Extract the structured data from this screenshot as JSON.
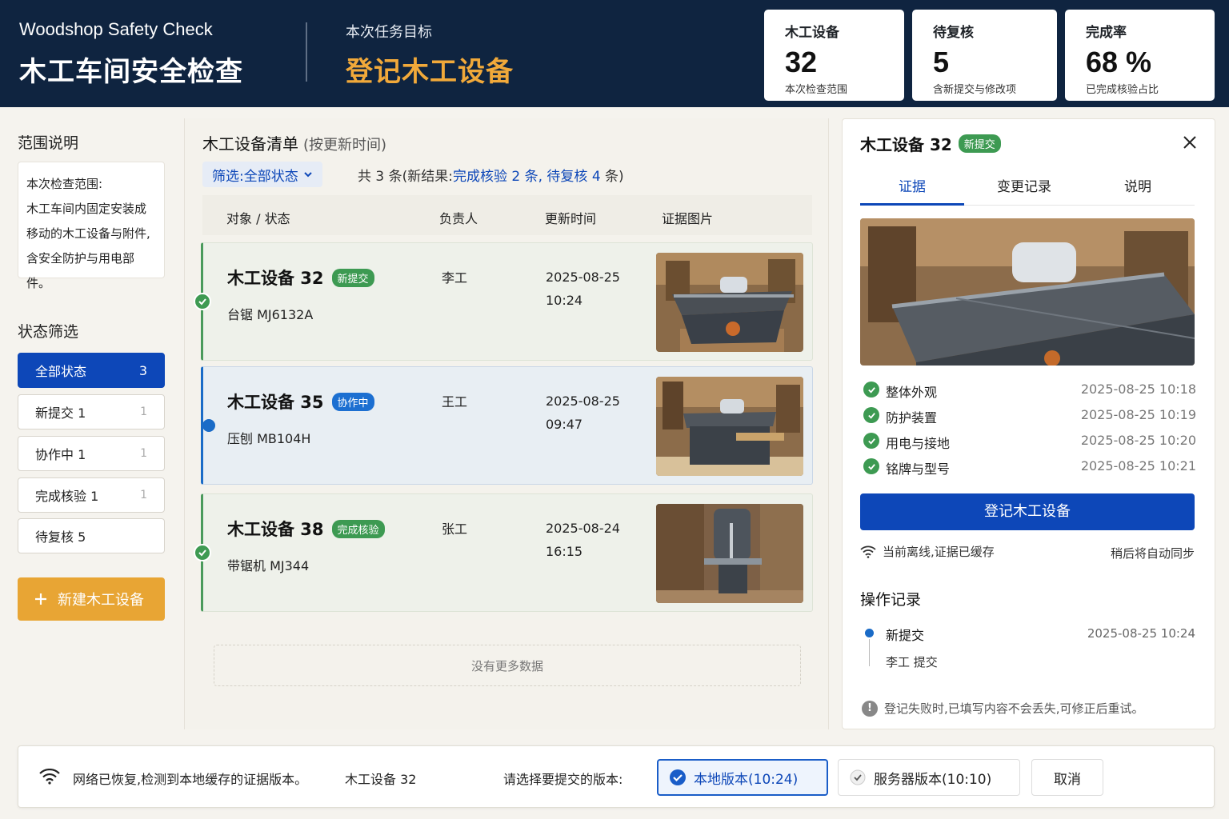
{
  "header": {
    "title_en": "Woodshop Safety Check",
    "title_cn": "木工车间安全检查",
    "goal_label": "本次任务目标",
    "goal_value": "登记木工设备",
    "stats": [
      {
        "label": "木工设备",
        "value": "32",
        "sub": "本次检查范围"
      },
      {
        "label": "待复核",
        "value": "5",
        "sub": "含新提交与修改项"
      },
      {
        "label": "完成率",
        "value": "68 %",
        "sub": "已完成核验占比"
      }
    ]
  },
  "sidebar": {
    "scope_title": "范围说明",
    "scope_lines": [
      "本次检查范围:",
      "木工车间内固定安装成",
      "移动的木工设备与附件,",
      "含安全防护与用电部件。"
    ],
    "filter_title": "状态筛选",
    "filters": [
      {
        "label": "全部状态",
        "count": "3"
      },
      {
        "label": "新提交  1",
        "count": "1"
      },
      {
        "label": "协作中  1",
        "count": "1"
      },
      {
        "label": "完成核验  1",
        "count": "1"
      },
      {
        "label": "待复核  5",
        "count": ""
      }
    ],
    "new_button": "新建木工设备"
  },
  "list": {
    "title": "木工设备清单",
    "title_sub": "(按更新时间)",
    "filter_label": "筛选:全部状态",
    "count_prefix": "共 3 条(新结果:",
    "count_done": "完成核验 2 条,",
    "count_review": "待复核 4",
    "count_suffix": " 条)",
    "columns": [
      "对象 / 状态",
      "负责人",
      "更新时间",
      "证据图片"
    ],
    "rows": [
      {
        "name": "木工设备 32",
        "badge": "新提交",
        "model": "台锯 MJ6132A",
        "owner": "李工",
        "date": "2025-08-25",
        "time": "10:24"
      },
      {
        "name": "木工设备 35",
        "badge": "协作中",
        "model": "压刨 MB104H",
        "owner": "王工",
        "date": "2025-08-25",
        "time": "09:47"
      },
      {
        "name": "木工设备 38",
        "badge": "完成核验",
        "model": "带锯机 MJ344",
        "owner": "张工",
        "date": "2025-08-24",
        "time": "16:15"
      }
    ],
    "no_more": "没有更多数据"
  },
  "detail": {
    "title": "木工设备 32",
    "badge": "新提交",
    "tabs": [
      "证据",
      "变更记录",
      "说明"
    ],
    "checks": [
      {
        "label": "整体外观",
        "time": "2025-08-25 10:18"
      },
      {
        "label": "防护装置",
        "time": "2025-08-25 10:19"
      },
      {
        "label": "用电与接地",
        "time": "2025-08-25 10:20"
      },
      {
        "label": "铭牌与型号",
        "time": "2025-08-25 10:21"
      }
    ],
    "primary_button": "登记木工设备",
    "offline_status": "当前离线,证据已缓存",
    "sync_note": "稍后将自动同步",
    "log_title": "操作记录",
    "log_action": "新提交",
    "log_time": "2025-08-25 10:24",
    "log_by": "李工 提交",
    "footer_note": "登记失败时,已填写内容不会丢失,可修正后重试。"
  },
  "bottom": {
    "message": "网络已恢复,检测到本地缓存的证据版本。",
    "item": "木工设备 32",
    "prompt": "请选择要提交的版本:",
    "local": "本地版本(10:24)",
    "server": "服务器版本(10:10)",
    "cancel": "取消"
  },
  "colors": {
    "navy": "#0f2440",
    "accent": "#f1a93a",
    "primary": "#0d47b8",
    "green": "#3d9a52"
  }
}
